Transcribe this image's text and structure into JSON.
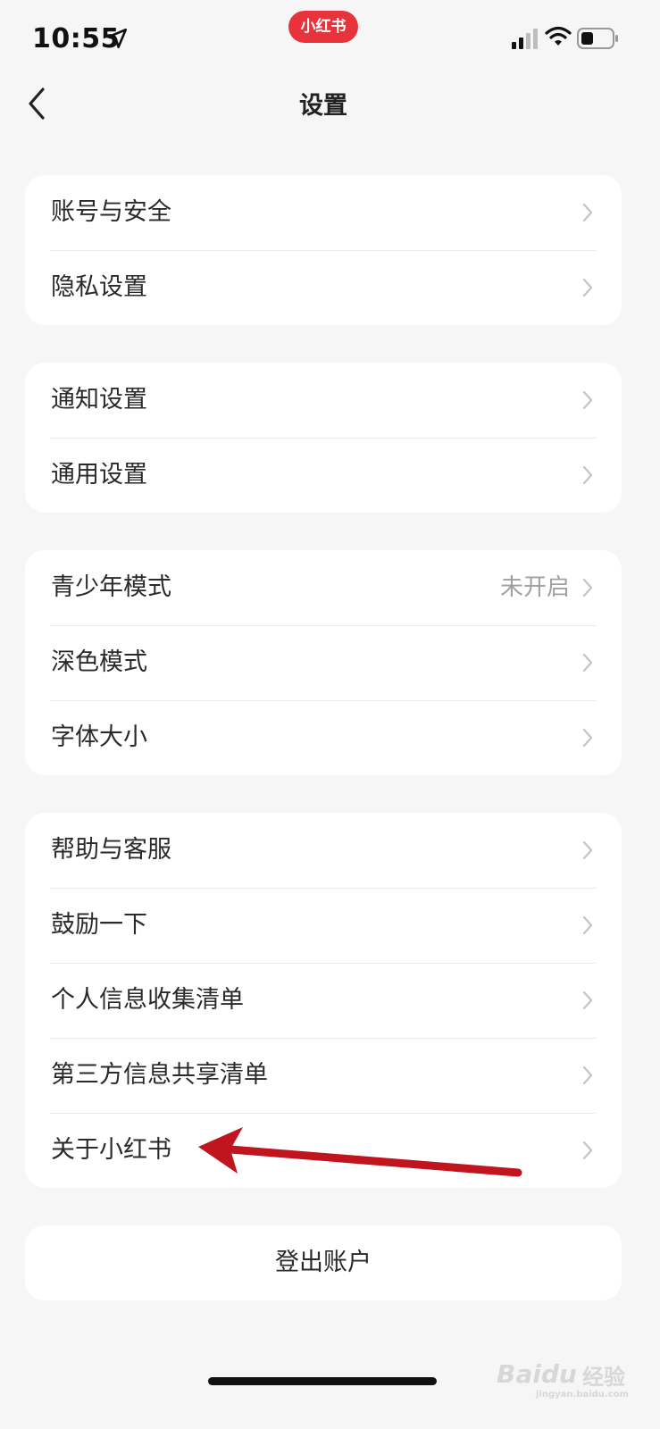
{
  "status_bar": {
    "time": "10:55",
    "app_badge": "小红书",
    "icons": [
      "location-arrow-icon",
      "cellular-signal-icon",
      "wifi-icon",
      "battery-icon"
    ]
  },
  "nav": {
    "title": "设置",
    "back_icon": "chevron-left-icon"
  },
  "groups": [
    {
      "items": [
        {
          "label": "账号与安全",
          "value": ""
        },
        {
          "label": "隐私设置",
          "value": ""
        }
      ]
    },
    {
      "items": [
        {
          "label": "通知设置",
          "value": ""
        },
        {
          "label": "通用设置",
          "value": ""
        }
      ]
    },
    {
      "items": [
        {
          "label": "青少年模式",
          "value": "未开启"
        },
        {
          "label": "深色模式",
          "value": ""
        },
        {
          "label": "字体大小",
          "value": ""
        }
      ]
    },
    {
      "items": [
        {
          "label": "帮助与客服",
          "value": ""
        },
        {
          "label": "鼓励一下",
          "value": ""
        },
        {
          "label": "个人信息收集清单",
          "value": ""
        },
        {
          "label": "第三方信息共享清单",
          "value": ""
        },
        {
          "label": "关于小红书",
          "value": ""
        }
      ]
    }
  ],
  "logout_label": "登出账户",
  "annotation": {
    "arrow_color": "#c0141e"
  },
  "watermark": {
    "logo": "Baidu",
    "text": "经验",
    "url": "jingyan.baidu.com"
  },
  "colors": {
    "background": "#f6f6f6",
    "card": "#ffffff",
    "brand_red": "#e8323c",
    "muted_text": "#a0a0a0"
  }
}
